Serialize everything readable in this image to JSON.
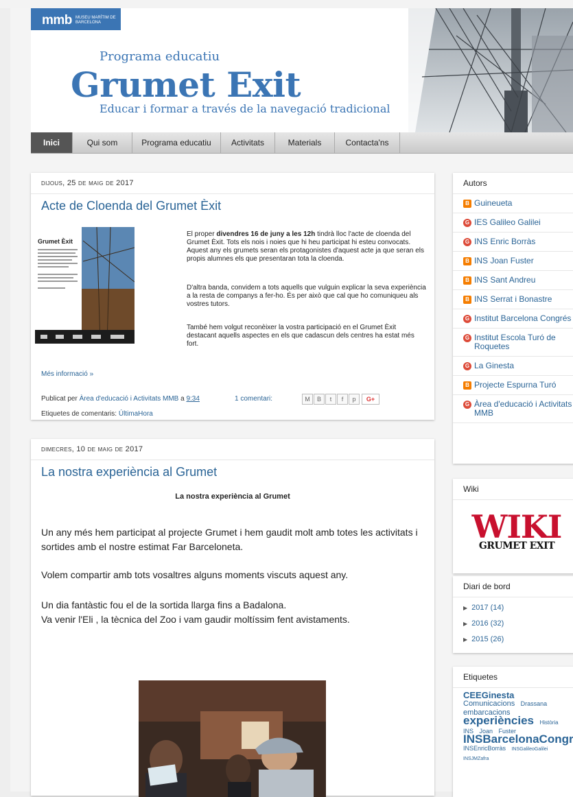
{
  "header": {
    "logo_main": "mmb",
    "logo_sub": "MUSEU MARÍTIM DE BARCELONA",
    "pretitle": "Programa educatiu",
    "title": "Grumet Exit",
    "tagline": "Educar i formar a través de la navegació tradicional"
  },
  "nav": [
    "Inici",
    "Qui som",
    "Programa educatiu",
    "Activitats",
    "Materials",
    "Contacta'ns"
  ],
  "posts": [
    {
      "date": "dijous, 25 de maig de 2017",
      "title": "Acte de Cloenda del Grumet Èxit",
      "p1_pre": "El proper ",
      "p1_bold": "divendres 16 de juny a les 12h",
      "p1_post": " tindrà lloc l'acte de cloenda del Grumet Èxit. Tots els nois i noies que hi heu participat hi esteu convocats. Aquest any els grumets seran els protagonistes d'aquest acte ja que seran els propis alumnes els que presentaran tota la cloenda.",
      "p2": "D'altra banda, convidem a tots aquells que vulguin explicar la seva experiència a la resta de companys a fer-ho. És per això que cal que ho comuniqueu als vostres tutors.",
      "p3": "També hem volgut reconèixer la vostra participació en el Grumet Èxit destacant aquells aspectes en els que cadascun dels centres ha estat més fort.",
      "poster_title": "Grumet Èxit",
      "more": "Més informació »",
      "published_by": "Publicat per",
      "author": "Àrea d'educació i Activitats MMB",
      "at": "a",
      "time": "9:34",
      "comments": "1 comentari:",
      "labels_prefix": "Etiquetes de comentaris:",
      "label": "ÚltimaHora"
    },
    {
      "date": "dimecres, 10 de maig de 2017",
      "title": "La nostra experiència al Grumet",
      "subtitle": "La nostra experiència al Grumet",
      "p1": "Un any més hem participat al projecte Grumet i hem gaudit molt amb totes les activitats i sortides amb el nostre estimat Far Barceloneta.",
      "p2": "Volem compartir amb tots vosaltres alguns moments viscuts aquest any.",
      "p3a": "Un dia fantàstic fou el de la sortida llarga fins a Badalona.",
      "p3b": "Va venir l'Eli , la tècnica del Zoo i vam gaudir moltíssim fent avistaments."
    }
  ],
  "sidebar": {
    "authors_title": "Autors",
    "authors": [
      {
        "name": "Guineueta",
        "icon": "blogger-icon"
      },
      {
        "name": "IES Galileo Galilei",
        "icon": "google-plus-icon"
      },
      {
        "name": "INS Enric Borràs",
        "icon": "google-plus-icon"
      },
      {
        "name": "INS Joan Fuster",
        "icon": "blogger-icon"
      },
      {
        "name": "INS Sant Andreu",
        "icon": "blogger-icon"
      },
      {
        "name": "INS Serrat i Bonastre",
        "icon": "blogger-icon"
      },
      {
        "name": "Institut Barcelona Congrés",
        "icon": "google-plus-icon"
      },
      {
        "name": "Institut Escola Turó de Roquetes",
        "icon": "google-plus-icon"
      },
      {
        "name": "La Ginesta",
        "icon": "google-plus-icon"
      },
      {
        "name": "Projecte Espurna Turó",
        "icon": "blogger-icon"
      },
      {
        "name": "Àrea d'educació i Activitats MMB",
        "icon": "google-plus-icon"
      }
    ],
    "wiki_title": "Wiki",
    "wiki_word": "WIKI",
    "wiki_sub": "GRUMET EXIT",
    "archive_title": "Diari de bord",
    "archive": [
      "2017 (14)",
      "2016 (32)",
      "2015 (26)"
    ],
    "labels_title": "Etiquetes",
    "labels": [
      {
        "t": "CEEGinesta",
        "size": 13
      },
      {
        "t": "Comunicacions",
        "size": 11
      },
      {
        "t": "Drassana",
        "size": 9
      },
      {
        "t": "embarcacions",
        "size": 11
      },
      {
        "t": "experiències",
        "size": 17
      },
      {
        "t": "Història",
        "size": 8
      },
      {
        "t": "INS",
        "size": 9
      },
      {
        "t": "Joan",
        "size": 9
      },
      {
        "t": "Fuster",
        "size": 9
      },
      {
        "t": "INSBarcelonaCongrés",
        "size": 17
      },
      {
        "t": "INSEnricBorràs",
        "size": 9
      },
      {
        "t": "INSGalileoGalilei",
        "size": 7
      },
      {
        "t": "INSJMZafra",
        "size": 7
      }
    ],
    "colors": {
      "link": "#2a6496",
      "brand": "#3b75b4",
      "wiki_red": "#c8102e"
    }
  }
}
